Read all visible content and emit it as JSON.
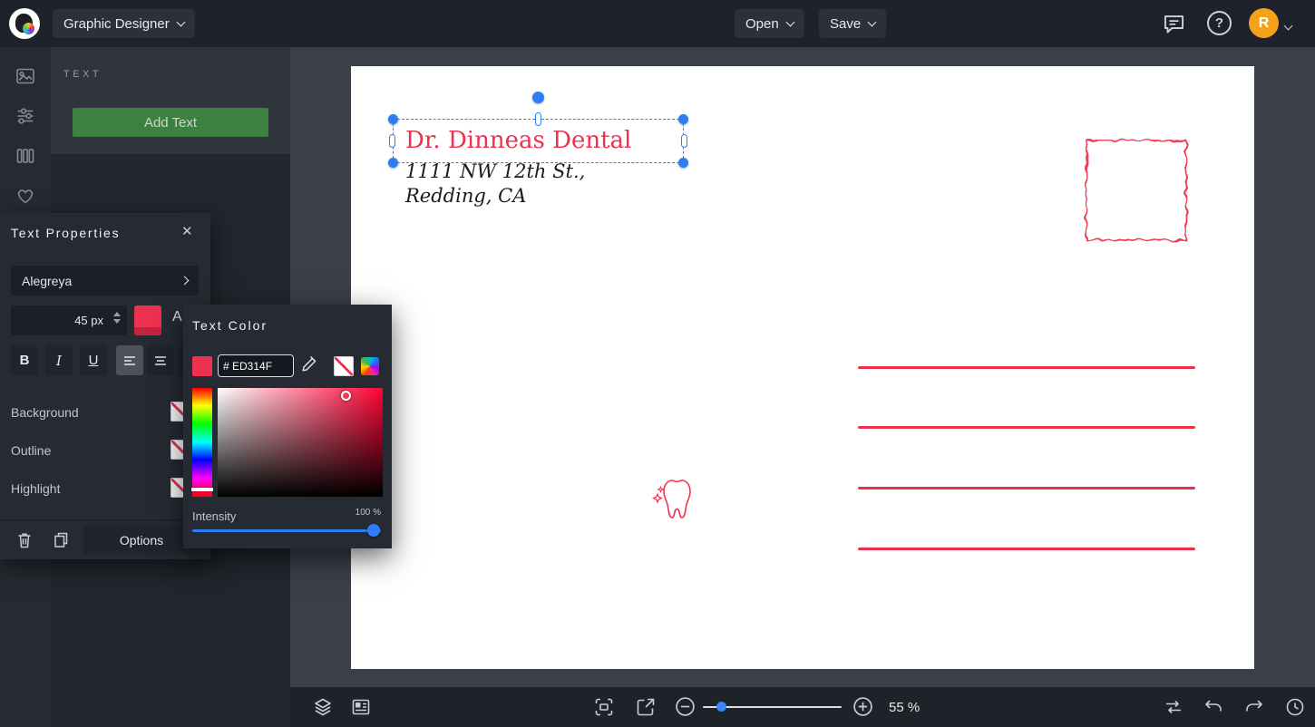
{
  "colors": {
    "accent": "#ED314F",
    "selection": "#2E7DF6",
    "add_button_green": "#3C8140",
    "avatar_orange": "#F5A21B"
  },
  "icons": {
    "close": "✕",
    "help": "?"
  },
  "topbar": {
    "menu_label": "Graphic Designer",
    "open_label": "Open",
    "save_label": "Save",
    "avatar_initial": "R"
  },
  "text_panel": {
    "section_title": "TEXT",
    "add_text_label": "Add Text"
  },
  "text_properties": {
    "title": "Text Properties",
    "font_name": "Alegreya",
    "font_size": "45 px",
    "bold_label": "B",
    "italic_label": "I",
    "underline_label": "U",
    "letter_spacing_label": "A",
    "background_label": "Background",
    "outline_label": "Outline",
    "highlight_label": "Highlight",
    "options_label": "Options"
  },
  "color_picker": {
    "title": "Text Color",
    "hex_value": "# ED314F",
    "intensity_label": "Intensity",
    "intensity_value": "100 %"
  },
  "canvas": {
    "heading_text": "Dr. Dinneas Dental",
    "address_line1": "1111 NW 12th St.,",
    "address_line2": "Redding, CA"
  },
  "bottom_bar": {
    "zoom_value": "55 %"
  }
}
